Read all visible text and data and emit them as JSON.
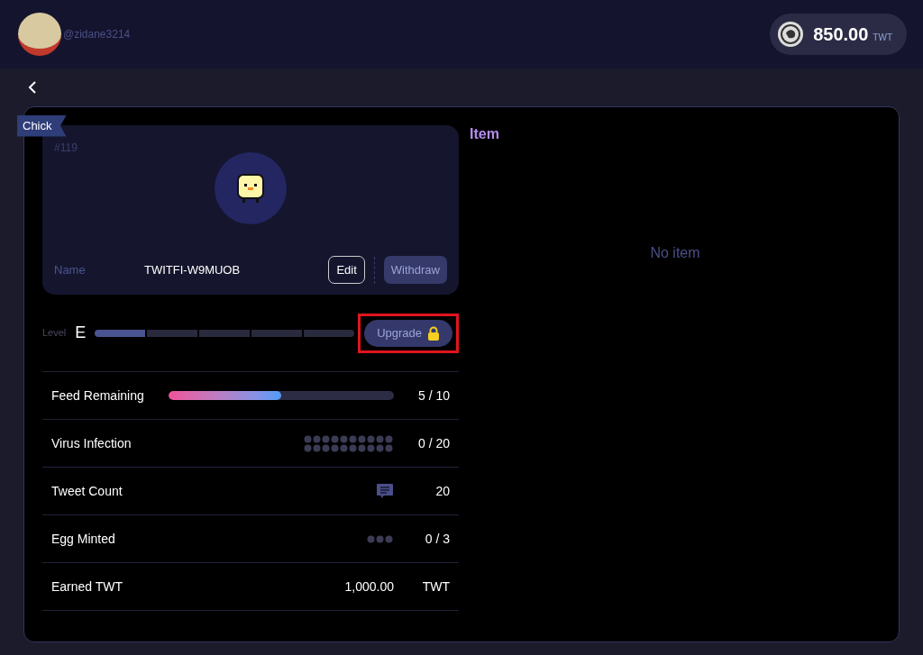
{
  "header": {
    "username": "@zidane3214",
    "balance": "850.00",
    "currency": "TWT"
  },
  "pet": {
    "type_badge": "Chick",
    "number": "#119",
    "name_label": "Name",
    "name": "TWITFI-W9MUOB",
    "edit_button": "Edit",
    "withdraw_button": "Withdraw"
  },
  "level": {
    "label": "Level",
    "grade": "E",
    "level": 0.2,
    "upgrade_button": "Upgrade",
    "locked": true,
    "highlighted": true
  },
  "stats": [
    {
      "kind": "bar",
      "label": "Feed Remaining",
      "level": 0.5,
      "value": "5 / 10"
    },
    {
      "kind": "dots20",
      "label": "Virus Infection",
      "value": "0 / 20"
    },
    {
      "kind": "icon",
      "label": "Tweet Count",
      "value": "20"
    },
    {
      "kind": "dots3",
      "label": "Egg Minted",
      "value": "0 / 3"
    },
    {
      "kind": "amount",
      "label": "Earned TWT",
      "amount": "1,000.00",
      "value": "TWT"
    }
  ],
  "items": {
    "title": "Item",
    "empty_text": "No item"
  }
}
